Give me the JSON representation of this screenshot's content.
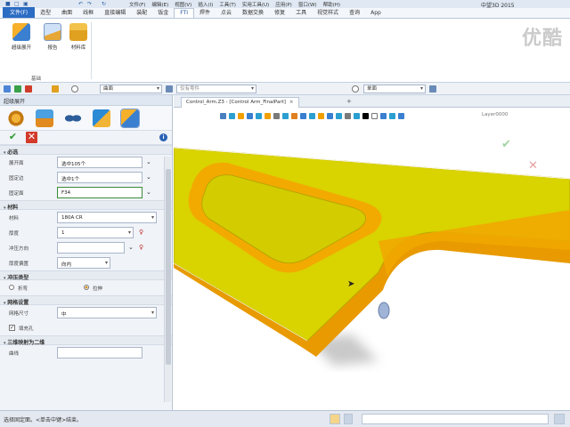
{
  "titlebar": {
    "menus": [
      "文件(F)",
      "编辑(E)",
      "视图(V)",
      "插入(I)",
      "工具(T)",
      "实用工具(U)",
      "应用(P)",
      "窗口(W)",
      "帮助(H)"
    ],
    "app_title": "中望3D 2015"
  },
  "ribbon_tabs": [
    "文件(F)",
    "造型",
    "曲面",
    "线框",
    "直接编辑",
    "装配",
    "钣金",
    "FTI",
    "焊件",
    "点云",
    "数据交换",
    "修复",
    "工具",
    "视觉样式",
    "查询",
    "App"
  ],
  "ribbon": {
    "buttons": [
      "超级展开",
      "报告",
      "材料库"
    ],
    "group_label": "基础"
  },
  "watermark": "优酷",
  "filterbar": {
    "filter_value": "曲面",
    "part_value": "仅有零件",
    "level_value": "单面"
  },
  "panel": {
    "title": "超级展开",
    "sections": {
      "required": "必选",
      "material": "材料",
      "stamp_type": "冲压类型",
      "mesh": "网格设置",
      "map": "三维映射为二维"
    },
    "fields": {
      "unfold_face_label": "展开面",
      "unfold_face_value": "选中105个",
      "fixed_edge_label": "固定边",
      "fixed_edge_value": "选中1个",
      "fixed_face_label": "固定面",
      "fixed_face_value": "F34",
      "material_label": "材料",
      "material_value": "180A CR",
      "thickness_label": "厚度",
      "thickness_value": "1",
      "press_dir_label": "冲压方向",
      "press_dir_value": "",
      "thickness_offset_label": "厚度偏置",
      "thickness_offset_value": "向内",
      "bend_label": "折弯",
      "stretch_label": "拉伸",
      "mesh_size_label": "网格尺寸",
      "mesh_size_value": "中",
      "fill_hole_label": "填充孔",
      "curve_label": "曲线"
    }
  },
  "doc_tab": {
    "label": "Control_Arm.Z3 - [Control Arm_FinalPart]",
    "close": "×",
    "new": "+"
  },
  "viewport": {
    "layer": "Layer0000"
  },
  "statusbar": {
    "message": "选择固定面。<单击中键>结束。"
  },
  "colors": {
    "part_yellow": "#d8d200",
    "part_orange": "#f0a000",
    "accent_blue": "#2b6cc4"
  }
}
